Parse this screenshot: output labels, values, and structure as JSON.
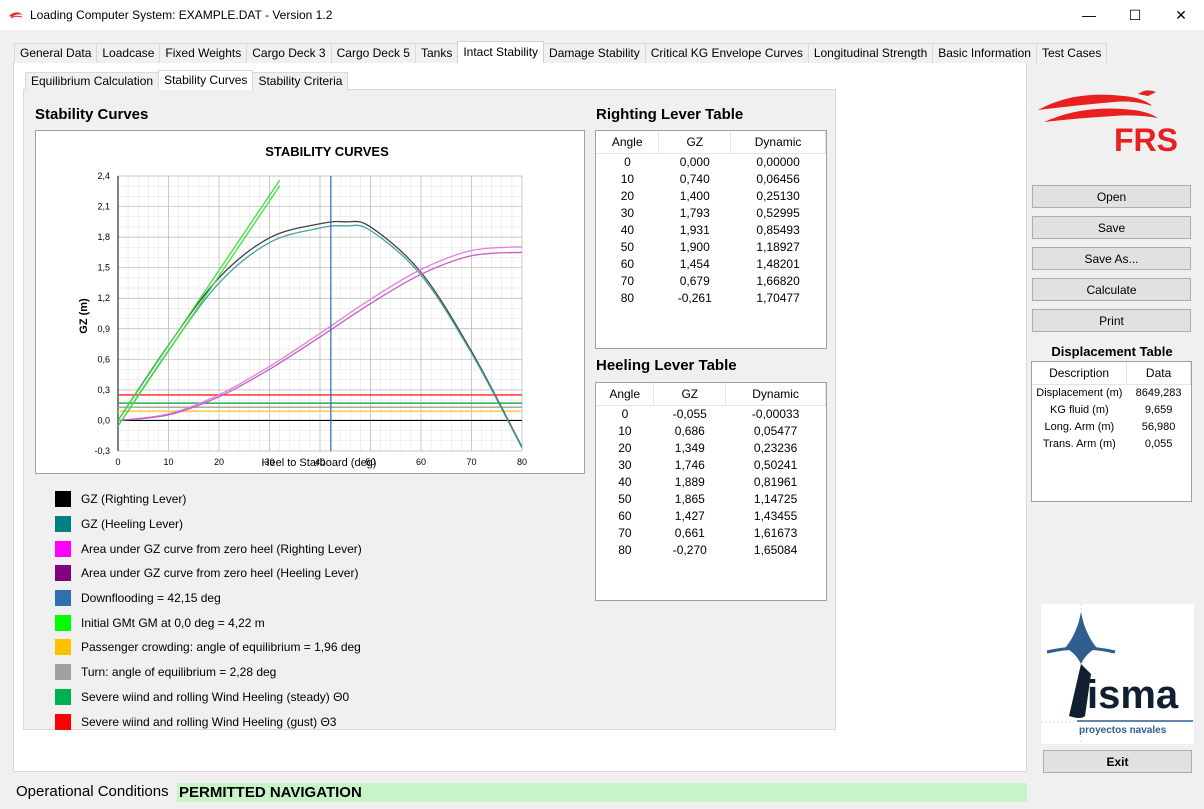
{
  "window": {
    "title": "Loading Computer System: EXAMPLE.DAT - Version 1.2",
    "minimize": "—",
    "maximize": "☐",
    "close": "✕"
  },
  "main_tabs": [
    "General Data",
    "Loadcase",
    "Fixed Weights",
    "Cargo Deck 3",
    "Cargo Deck 5",
    "Tanks",
    "Intact Stability",
    "Damage Stability",
    "Critical KG Envelope Curves",
    "Longitudinal Strength",
    "Basic Information",
    "Test Cases"
  ],
  "sub_tabs": [
    "Equilibrium Calculation",
    "Stability Curves",
    "Stability Criteria"
  ],
  "stability_curves_title": "Stability Curves",
  "chart_data": {
    "type": "line",
    "title": "STABILITY CURVES",
    "xlabel": "Heel to Starboard (deg)",
    "ylabel": "GZ (m)",
    "xlim": [
      0,
      80
    ],
    "ylim": [
      -0.3,
      2.4
    ],
    "xticks": [
      "0",
      "10",
      "20",
      "30",
      "40",
      "50",
      "60",
      "70",
      "80"
    ],
    "yticks": [
      "-0,3",
      "0,0",
      "0,3",
      "0,6",
      "0,9",
      "1,2",
      "1,5",
      "1,8",
      "2,1",
      "2,4"
    ],
    "grid": true,
    "series": [
      {
        "name": "GZ (Righting Lever)",
        "color": "#404040",
        "x": [
          0,
          10,
          20,
          30,
          40,
          45,
          50,
          60,
          70,
          80
        ],
        "y": [
          0,
          0.74,
          1.4,
          1.793,
          1.931,
          1.95,
          1.9,
          1.454,
          0.679,
          -0.261
        ]
      },
      {
        "name": "GZ (Heeling Lever)",
        "color": "#4aa0a0",
        "x": [
          0,
          10,
          20,
          30,
          40,
          45,
          50,
          60,
          70,
          80
        ],
        "y": [
          -0.055,
          0.686,
          1.349,
          1.746,
          1.889,
          1.91,
          1.865,
          1.427,
          0.661,
          -0.27
        ]
      },
      {
        "name": "Area under GZ curve from zero heel (Righting Lever)",
        "color": "#e080e0",
        "x": [
          0,
          10,
          20,
          30,
          40,
          50,
          60,
          70,
          80
        ],
        "y": [
          0,
          0.06456,
          0.2513,
          0.52995,
          0.85493,
          1.18927,
          1.48201,
          1.6682,
          1.70477
        ]
      },
      {
        "name": "Area under GZ curve from zero heel (Heeling Lever)",
        "color": "#c060c0",
        "x": [
          0,
          10,
          20,
          30,
          40,
          50,
          60,
          70,
          80
        ],
        "y": [
          -0.00033,
          0.05477,
          0.23236,
          0.50241,
          0.81961,
          1.14725,
          1.43455,
          1.61673,
          1.65084
        ]
      },
      {
        "name": "Downflooding = 42,15 deg",
        "color": "#3070b0",
        "vline": 42.15
      },
      {
        "name": "Initial GMt GM at 0,0 deg = 4,22 m",
        "color": "#40e040",
        "x": [
          0,
          32
        ],
        "y": [
          0,
          2.357
        ]
      },
      {
        "name": "Passenger crowding: angle of equilibrium = 1,96 deg",
        "color": "#ffd040",
        "hline": 0.09
      },
      {
        "name": "Turn: angle of equilibrium = 2,28 deg",
        "color": "#a0a0a0",
        "hline": 0.13
      },
      {
        "name": "Severe wiind and rolling Wind Heeling (steady) Θ0",
        "color": "#20b050",
        "hline": 0.17
      },
      {
        "name": "Severe wiind and rolling Wind Heeling (gust) Θ3",
        "color": "#ff2020",
        "hline": 0.25
      }
    ]
  },
  "legend": [
    {
      "label": "GZ (Righting Lever)",
      "color": "#000000"
    },
    {
      "label": "GZ (Heeling Lever)",
      "color": "#008080"
    },
    {
      "label": "Area under GZ curve from zero heel (Righting Lever)",
      "color": "#ff00ff"
    },
    {
      "label": "Area under GZ curve from zero heel (Heeling Lever)",
      "color": "#800080"
    },
    {
      "label": "Downflooding = 42,15 deg",
      "color": "#3070b0"
    },
    {
      "label": "Initial GMt GM at 0,0 deg = 4,22 m",
      "color": "#00ff00"
    },
    {
      "label": "Passenger crowding: angle of equilibrium = 1,96 deg",
      "color": "#ffc000"
    },
    {
      "label": "Turn: angle of equilibrium = 2,28 deg",
      "color": "#a0a0a0"
    },
    {
      "label": "Severe wiind and rolling Wind Heeling (steady) Θ0",
      "color": "#00b050"
    },
    {
      "label": "Severe wiind and rolling Wind Heeling (gust) Θ3",
      "color": "#ff0000"
    }
  ],
  "righting_table": {
    "title": "Righting Lever Table",
    "headers": [
      "Angle",
      "GZ",
      "Dynamic"
    ],
    "rows": [
      [
        "0",
        "0,000",
        "0,00000"
      ],
      [
        "10",
        "0,740",
        "0,06456"
      ],
      [
        "20",
        "1,400",
        "0,25130"
      ],
      [
        "30",
        "1,793",
        "0,52995"
      ],
      [
        "40",
        "1,931",
        "0,85493"
      ],
      [
        "50",
        "1,900",
        "1,18927"
      ],
      [
        "60",
        "1,454",
        "1,48201"
      ],
      [
        "70",
        "0,679",
        "1,66820"
      ],
      [
        "80",
        "-0,261",
        "1,70477"
      ]
    ]
  },
  "heeling_table": {
    "title": "Heeling Lever Table",
    "headers": [
      "Angle",
      "GZ",
      "Dynamic"
    ],
    "rows": [
      [
        "0",
        "-0,055",
        "-0,00033"
      ],
      [
        "10",
        "0,686",
        "0,05477"
      ],
      [
        "20",
        "1,349",
        "0,23236"
      ],
      [
        "30",
        "1,746",
        "0,50241"
      ],
      [
        "40",
        "1,889",
        "0,81961"
      ],
      [
        "50",
        "1,865",
        "1,14725"
      ],
      [
        "60",
        "1,427",
        "1,43455"
      ],
      [
        "70",
        "0,661",
        "1,61673"
      ],
      [
        "80",
        "-0,270",
        "1,65084"
      ]
    ]
  },
  "buttons": {
    "open": "Open",
    "save": "Save",
    "save_as": "Save As...",
    "calculate": "Calculate",
    "print": "Print",
    "exit": "Exit"
  },
  "displacement_table": {
    "title": "Displacement Table",
    "headers": [
      "Description",
      "Data"
    ],
    "rows": [
      [
        "Displacement (m)",
        "8649,283"
      ],
      [
        "KG fluid (m)",
        "9,659"
      ],
      [
        "Long. Arm (m)",
        "56,980"
      ],
      [
        "Trans. Arm (m)",
        "0,055"
      ]
    ]
  },
  "operational": {
    "label": "Operational Conditions",
    "status": "PERMITTED NAVIGATION",
    "status_color": "#c8f5c8"
  },
  "logos": {
    "frs": "FRS",
    "visma": "isma",
    "visma_sub": "proyectos navales"
  }
}
